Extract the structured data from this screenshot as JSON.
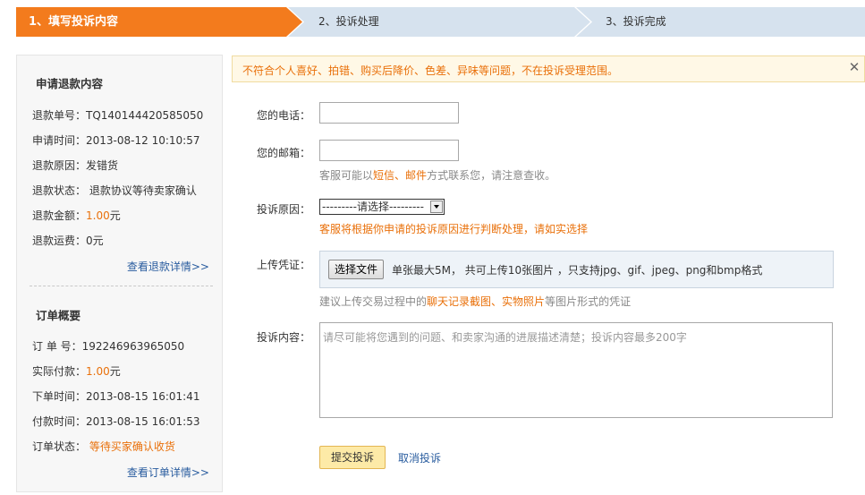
{
  "steps": [
    "1、填写投诉内容",
    "2、投诉处理",
    "3、投诉完成"
  ],
  "colors": {
    "active_step": "#f37b1d",
    "inactive_step": "#d6e2ee",
    "accent": "#e9700a",
    "link": "#2a5d9f"
  },
  "refund": {
    "title": "申请退款内容",
    "rows": [
      {
        "label": "退款单号：",
        "value": "TQ140144420585050"
      },
      {
        "label": "申请时间：",
        "value": "2013-08-12 10:10:57"
      },
      {
        "label": "退款原因：",
        "value": "发错货"
      },
      {
        "label": "退款状态：",
        "value": " 退款协议等待卖家确认"
      },
      {
        "label": "退款金额：",
        "value": "1.00",
        "suffix": "元"
      },
      {
        "label": "退款运费：",
        "value": "0元"
      }
    ],
    "link": "查看退款详情>>"
  },
  "order": {
    "title": "订单概要",
    "rows": [
      {
        "label": "订 单 号：",
        "value": "192246963965050"
      },
      {
        "label": "实际付款：",
        "value": "1.00",
        "suffix": "元"
      },
      {
        "label": "下单时间：",
        "value": "2013-08-15 16:01:41"
      },
      {
        "label": "付款时间：",
        "value": "2013-08-15 16:01:53"
      },
      {
        "label": "订单状态：",
        "value": " 等待买家确认收货"
      }
    ],
    "link": "查看订单详情>>"
  },
  "notice": {
    "text": "不符合个人喜好、拍错、购买后降价、色差、异味等问题，不在投诉受理范围。",
    "close": "✕"
  },
  "form": {
    "phone_label": "您的电话：",
    "email_label": "您的邮箱：",
    "contact_hint": {
      "pre": "客服可能以",
      "sms": "短信",
      "sep": "、",
      "mail": "邮件",
      "post": "方式联系您，请注意查收。"
    },
    "reason_label": "投诉原因：",
    "reason_selected": "---------请选择---------",
    "reason_warn": "客服将根据你申请的投诉原因进行判断处理，请如实选择",
    "upload_label": "上传凭证：",
    "file_button": "选择文件",
    "upload_info": "单张最大5M， 共可上传10张图片 ，只支持jpg、gif、jpeg、png和bmp格式",
    "upload_hint": {
      "pre": "建议上传交易过程中的",
      "chat": "聊天记录截图",
      "sep": "、",
      "photo": "实物照片",
      "post": "等图片形式的凭证"
    },
    "content_label": "投诉内容：",
    "content_placeholder": "请尽可能将您遇到的问题、和卖家沟通的进展描述清楚；投诉内容最多200字",
    "submit": "提交投诉",
    "cancel": "取消投诉"
  }
}
